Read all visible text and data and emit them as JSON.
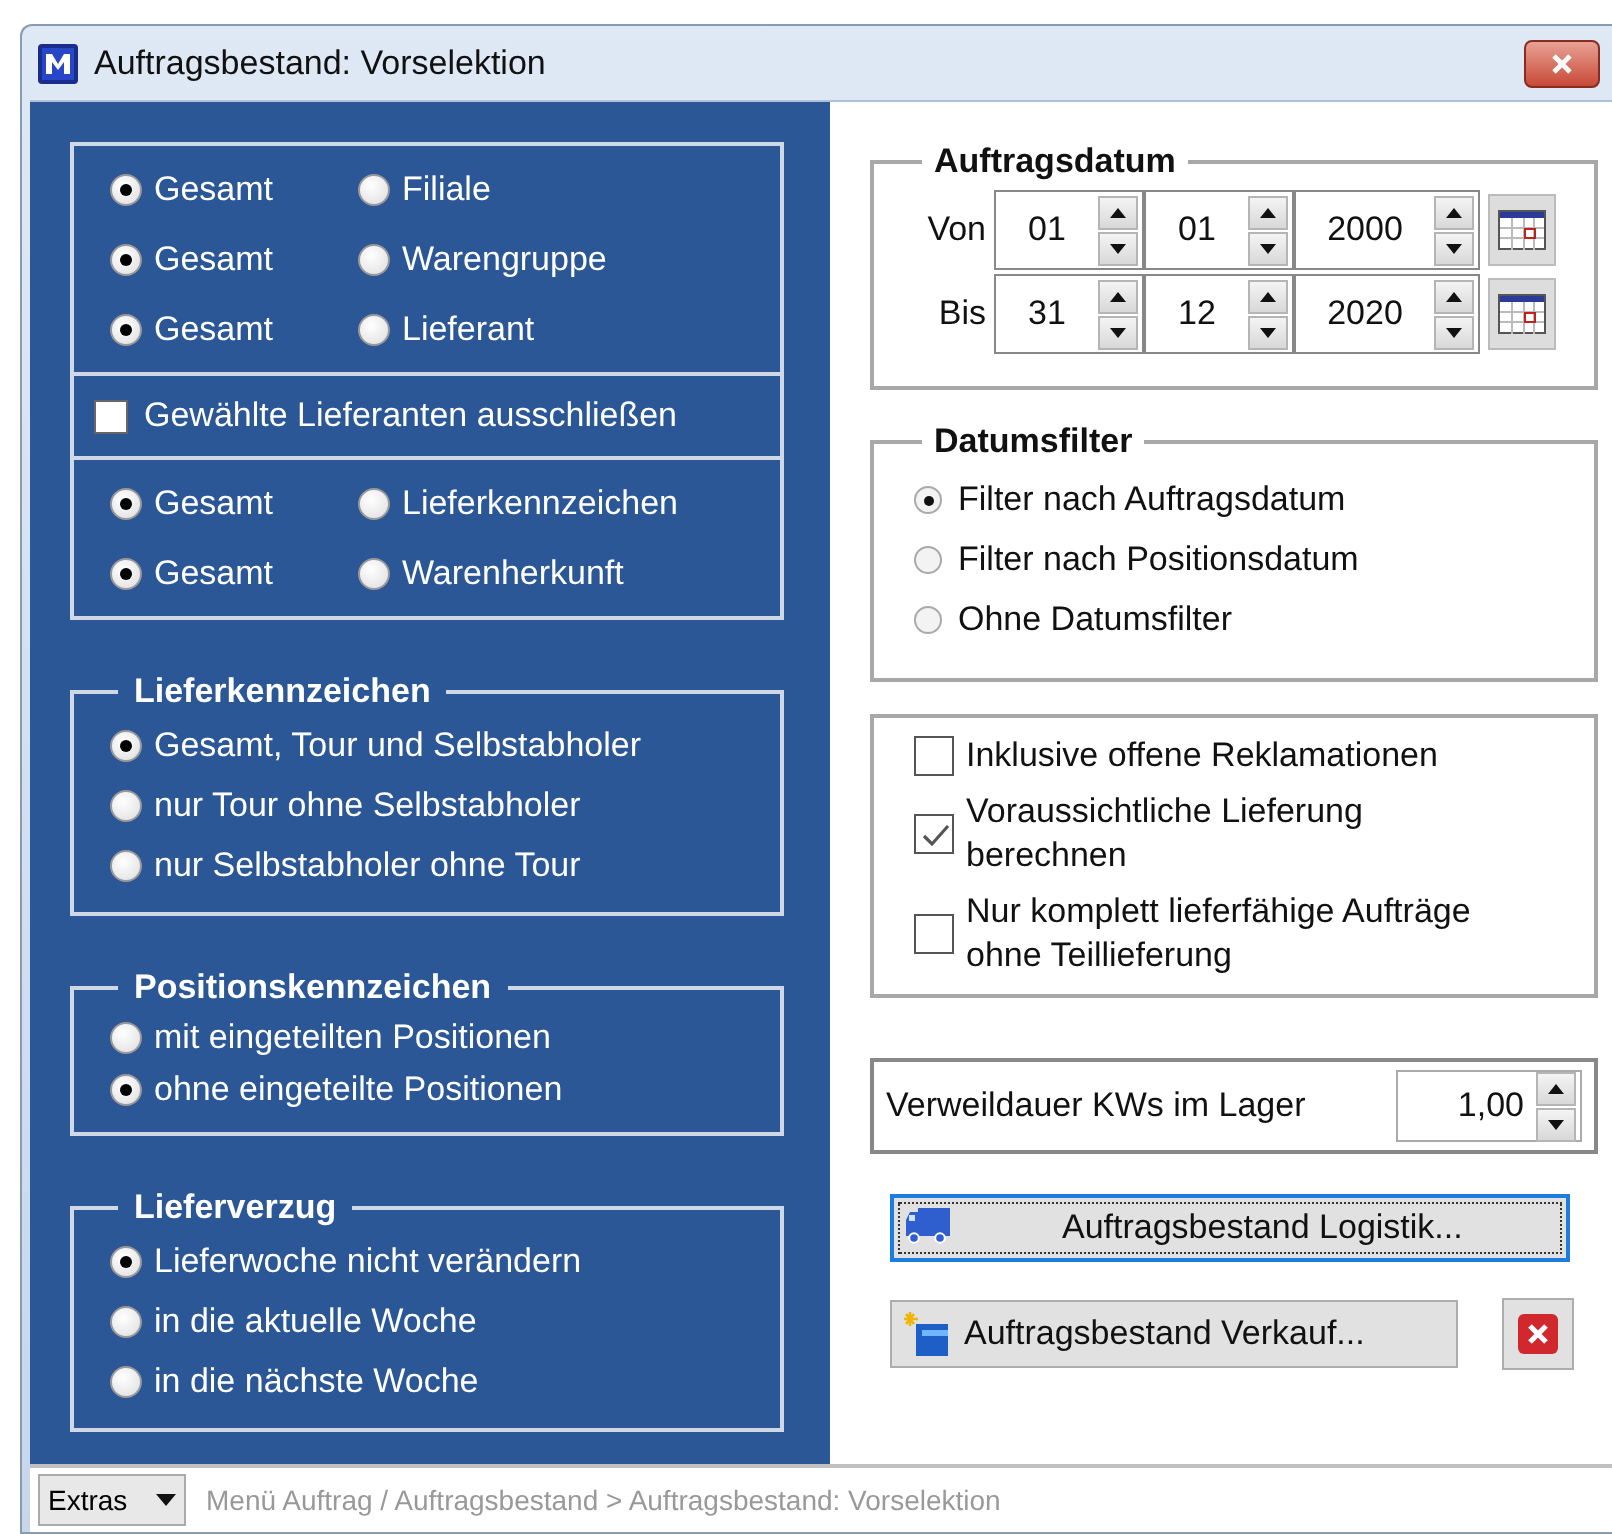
{
  "window": {
    "title": "Auftragsbestand: Vorselektion"
  },
  "selection_box": {
    "sections": [
      {
        "kind": "radio_rows",
        "rows": [
          [
            {
              "label": "Gesamt",
              "selected": true
            },
            {
              "label": "Filiale",
              "selected": false
            }
          ],
          [
            {
              "label": "Gesamt",
              "selected": true
            },
            {
              "label": "Warengruppe",
              "selected": false
            }
          ],
          [
            {
              "label": "Gesamt",
              "selected": true
            },
            {
              "label": "Lieferant",
              "selected": false
            }
          ]
        ]
      },
      {
        "kind": "checkbox",
        "label": "Gewählte Lieferanten ausschließen",
        "checked": false
      },
      {
        "kind": "radio_rows",
        "rows": [
          [
            {
              "label": "Gesamt",
              "selected": true
            },
            {
              "label": "Lieferkennzeichen",
              "selected": false
            }
          ],
          [
            {
              "label": "Gesamt",
              "selected": true
            },
            {
              "label": "Warenherkunft",
              "selected": false
            }
          ]
        ]
      }
    ]
  },
  "left_groups": [
    {
      "title": "Lieferkennzeichen",
      "options": [
        {
          "label": "Gesamt, Tour und Selbstabholer",
          "selected": true
        },
        {
          "label": "nur Tour ohne Selbstabholer",
          "selected": false
        },
        {
          "label": "nur Selbstabholer ohne Tour",
          "selected": false
        }
      ]
    },
    {
      "title": "Positionskennzeichen",
      "options": [
        {
          "label": "mit eingeteilten Positionen",
          "selected": false
        },
        {
          "label": "ohne eingeteilte Positionen",
          "selected": true
        }
      ]
    },
    {
      "title": "Lieferverzug",
      "options": [
        {
          "label": "Lieferwoche nicht verändern",
          "selected": true
        },
        {
          "label": "in die aktuelle Woche",
          "selected": false
        },
        {
          "label": "in die nächste Woche",
          "selected": false
        }
      ]
    }
  ],
  "auftragsdatum": {
    "title": "Auftragsdatum",
    "rows": [
      {
        "label": "Von",
        "day": "01",
        "month": "01",
        "year": "2000"
      },
      {
        "label": "Bis",
        "day": "31",
        "month": "12",
        "year": "2020"
      }
    ]
  },
  "datumsfilter": {
    "title": "Datumsfilter",
    "options": [
      {
        "label": "Filter nach Auftragsdatum",
        "selected": true
      },
      {
        "label": "Filter nach Positionsdatum",
        "selected": false
      },
      {
        "label": "Ohne Datumsfilter",
        "selected": false
      }
    ]
  },
  "options": {
    "checkboxes": [
      {
        "label": "Inklusive offene Reklamationen",
        "checked": false
      },
      {
        "label": "Voraussichtliche Lieferung berechnen",
        "checked": true
      },
      {
        "label": "Nur komplett lieferfähige Aufträge ohne Teillieferung",
        "checked": false
      }
    ]
  },
  "verweildauer": {
    "label": "Verweildauer KWs im Lager",
    "value": "1,00"
  },
  "buttons": [
    {
      "kind": "logistik",
      "label": "Auftragsbestand Logistik...",
      "focused": true
    },
    {
      "kind": "verkauf",
      "label": "Auftragsbestand Verkauf...",
      "focused": false
    }
  ],
  "status_bar": {
    "dropdown": "Extras",
    "breadcrumb": "Menü Auftrag / Auftragsbestand > Auftragsbestand: Vorselektion"
  }
}
